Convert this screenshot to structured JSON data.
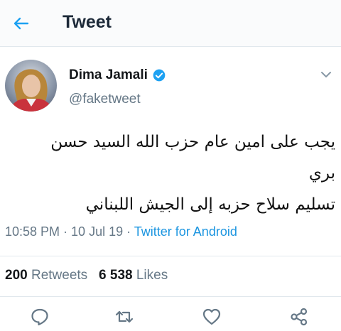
{
  "header": {
    "title": "Tweet",
    "back_icon": "back-arrow-icon"
  },
  "author": {
    "name": "Dima Jamali",
    "handle": "@faketweet",
    "verified_icon": "verified-badge-icon"
  },
  "tweet": {
    "line1": "يجب على امين عام حزب الله السيد حسن بري",
    "line2": "تسليم سلاح حزبه إلى الجيش اللبناني"
  },
  "meta": {
    "time": "10:58 PM",
    "sep1": " · ",
    "date": "10 Jul 19",
    "sep2": " · ",
    "source": "Twitter for Android"
  },
  "stats": {
    "retweets_count": "200",
    "retweets_label": "Retweets",
    "likes_count": "6 538",
    "likes_label": "Likes"
  },
  "actions": [
    "reply-icon",
    "retweet-icon",
    "like-icon",
    "share-icon"
  ],
  "colors": {
    "accent": "#1da1f2",
    "secondary_text": "#657786",
    "divider": "#e1e8ed"
  }
}
